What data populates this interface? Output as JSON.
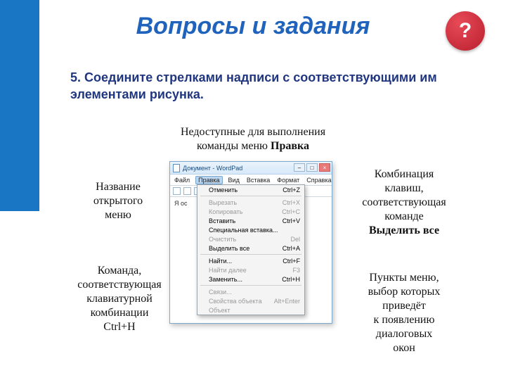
{
  "title": "Вопросы и задания",
  "badge": "?",
  "task": {
    "num": "5.",
    "body": "Соедините стрелками надписи с соответствующими им элементами рисунка."
  },
  "labels": {
    "top": {
      "l1": "Недоступные для выполнения",
      "l2": "команды меню ",
      "bold": "Правка"
    },
    "left1": {
      "l1": "Название",
      "l2": "открытого",
      "l3": "меню"
    },
    "left2": {
      "l1": "Команда,",
      "l2": "соответствующая",
      "l3": "клавиатурной",
      "l4": "комбинации",
      "l5": "Ctrl+H"
    },
    "right1": {
      "l1": "Комбинация",
      "l2": "клавиш,",
      "l3": "соответствующая",
      "l4": "команде",
      "bold": "Выделить все"
    },
    "right2": {
      "l1": "Пункты меню,",
      "l2": "выбор которых",
      "l3": "приведёт",
      "l4": "к появлению",
      "l5": "диалоговых",
      "l6": "окон"
    }
  },
  "window": {
    "title": "Документ - WordPad",
    "win_min": "–",
    "win_max": "□",
    "win_close": "×",
    "menubar": [
      "Файл",
      "Правка",
      "Вид",
      "Вставка",
      "Формат",
      "Справка"
    ],
    "doc_text": "Я ос"
  },
  "dropdown": [
    {
      "label": "Отменить",
      "shortcut": "Ctrl+Z",
      "disabled": false,
      "sep_after": true
    },
    {
      "label": "Вырезать",
      "shortcut": "Ctrl+X",
      "disabled": true,
      "sep_after": false
    },
    {
      "label": "Копировать",
      "shortcut": "Ctrl+C",
      "disabled": true,
      "sep_after": false
    },
    {
      "label": "Вставить",
      "shortcut": "Ctrl+V",
      "disabled": false,
      "sep_after": false
    },
    {
      "label": "Специальная вставка...",
      "shortcut": "",
      "disabled": false,
      "sep_after": false
    },
    {
      "label": "Очистить",
      "shortcut": "Del",
      "disabled": true,
      "sep_after": false
    },
    {
      "label": "Выделить все",
      "shortcut": "Ctrl+A",
      "disabled": false,
      "sep_after": true
    },
    {
      "label": "Найти...",
      "shortcut": "Ctrl+F",
      "disabled": false,
      "sep_after": false
    },
    {
      "label": "Найти далее",
      "shortcut": "F3",
      "disabled": true,
      "sep_after": false
    },
    {
      "label": "Заменить...",
      "shortcut": "Ctrl+H",
      "disabled": false,
      "sep_after": true
    },
    {
      "label": "Связи...",
      "shortcut": "",
      "disabled": true,
      "sep_after": false
    },
    {
      "label": "Свойства объекта",
      "shortcut": "Alt+Enter",
      "disabled": true,
      "sep_after": false
    },
    {
      "label": "Объект",
      "shortcut": "",
      "disabled": true,
      "sep_after": false
    }
  ]
}
